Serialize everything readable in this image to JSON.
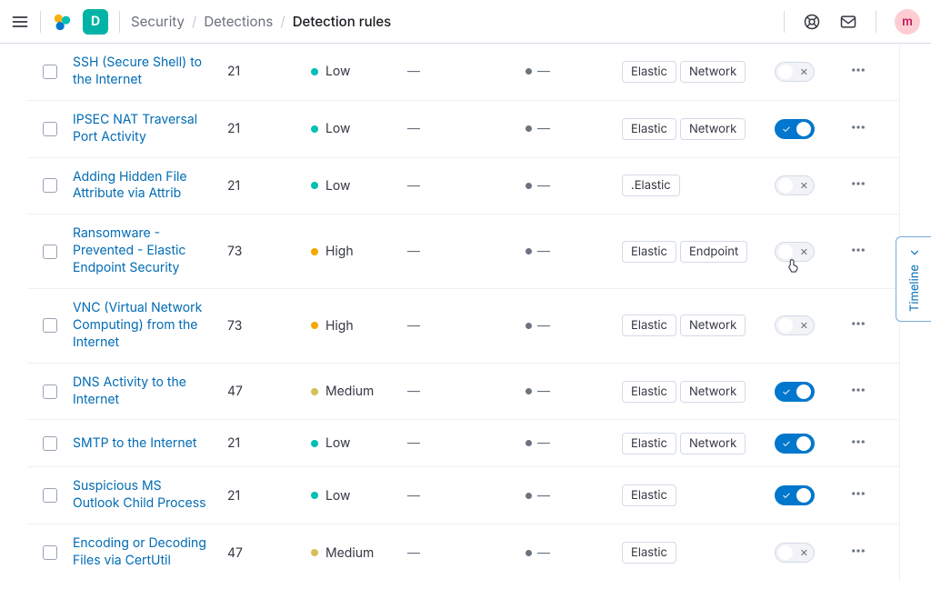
{
  "header": {
    "breadcrumb": [
      "Security",
      "Detections",
      "Detection rules"
    ],
    "space_initial": "D",
    "avatar_initial": "m"
  },
  "timeline": {
    "label": "Timeline"
  },
  "em_dash": "—",
  "rules": [
    {
      "name": "SSH (Secure Shell) to the Internet",
      "risk": "21",
      "severity": "Low",
      "sev_class": "sev-low",
      "last_run": "—",
      "last_response": "—",
      "tags": [
        "Elastic",
        "Network"
      ],
      "enabled": false
    },
    {
      "name": "IPSEC NAT Traversal Port Activity",
      "risk": "21",
      "severity": "Low",
      "sev_class": "sev-low",
      "last_run": "—",
      "last_response": "—",
      "tags": [
        "Elastic",
        "Network"
      ],
      "enabled": true
    },
    {
      "name": "Adding Hidden File Attribute via Attrib",
      "risk": "21",
      "severity": "Low",
      "sev_class": "sev-low",
      "last_run": "—",
      "last_response": "—",
      "tags": [
        ".Elastic"
      ],
      "enabled": false
    },
    {
      "name": "Ransomware - Prevented - Elastic Endpoint Security",
      "risk": "73",
      "severity": "High",
      "sev_class": "sev-high",
      "last_run": "—",
      "last_response": "—",
      "tags": [
        "Elastic",
        "Endpoint"
      ],
      "enabled": false,
      "cursor": true
    },
    {
      "name": "VNC (Virtual Network Computing) from the Internet",
      "risk": "73",
      "severity": "High",
      "sev_class": "sev-high",
      "last_run": "—",
      "last_response": "—",
      "tags": [
        "Elastic",
        "Network"
      ],
      "enabled": false
    },
    {
      "name": "DNS Activity to the Internet",
      "risk": "47",
      "severity": "Medium",
      "sev_class": "sev-med",
      "last_run": "—",
      "last_response": "—",
      "tags": [
        "Elastic",
        "Network"
      ],
      "enabled": true
    },
    {
      "name": "SMTP to the Internet",
      "risk": "21",
      "severity": "Low",
      "sev_class": "sev-low",
      "last_run": "—",
      "last_response": "—",
      "tags": [
        "Elastic",
        "Network"
      ],
      "enabled": true
    },
    {
      "name": "Suspicious MS Outlook Child Process",
      "risk": "21",
      "severity": "Low",
      "sev_class": "sev-low",
      "last_run": "—",
      "last_response": "—",
      "tags": [
        "Elastic"
      ],
      "enabled": true
    },
    {
      "name": "Encoding or Decoding Files via CertUtil",
      "risk": "47",
      "severity": "Medium",
      "sev_class": "sev-med",
      "last_run": "—",
      "last_response": "—",
      "tags": [
        "Elastic"
      ],
      "enabled": false
    }
  ]
}
